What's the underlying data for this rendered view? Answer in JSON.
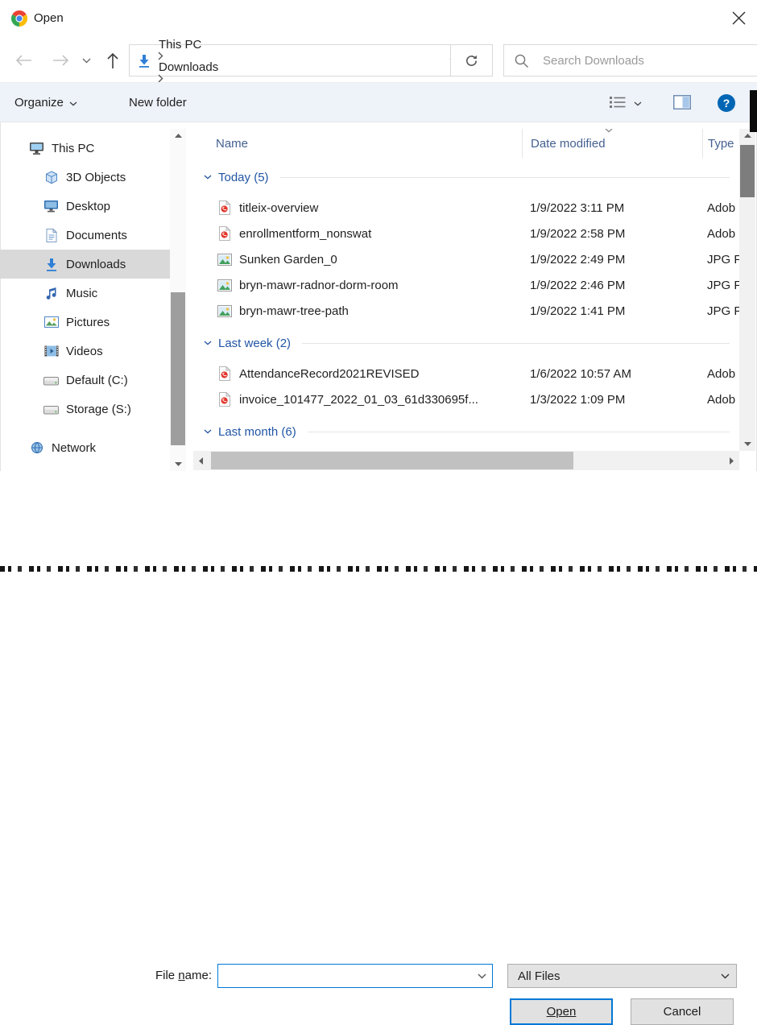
{
  "titlebar": {
    "title": "Open",
    "app_icon": "chrome-logo",
    "close_icon": "close-x"
  },
  "nav": {
    "back_icon": "arrow-left",
    "forward_icon": "arrow-right",
    "recent_icon": "chevron-down",
    "up_icon": "arrow-up",
    "breadcrumb": {
      "location_icon": "downloads-folder",
      "items": [
        "This PC",
        "Downloads"
      ]
    },
    "refresh_icon": "refresh",
    "search": {
      "icon": "magnifier",
      "placeholder": "Search Downloads",
      "value": ""
    }
  },
  "toolbar": {
    "organize_label": "Organize",
    "new_folder_label": "New folder",
    "view_icon": "list-view",
    "preview_icon": "preview-pane",
    "help_icon": "help-question"
  },
  "sidebar": {
    "items": [
      {
        "label": "This PC",
        "icon": "pc",
        "level": 0,
        "selected": false,
        "gap_before": false
      },
      {
        "label": "3D Objects",
        "icon": "cube",
        "level": 1,
        "selected": false,
        "gap_before": false
      },
      {
        "label": "Desktop",
        "icon": "desktop",
        "level": 1,
        "selected": false,
        "gap_before": false
      },
      {
        "label": "Documents",
        "icon": "documents",
        "level": 1,
        "selected": false,
        "gap_before": false
      },
      {
        "label": "Downloads",
        "icon": "downloads",
        "level": 1,
        "selected": true,
        "gap_before": false
      },
      {
        "label": "Music",
        "icon": "music",
        "level": 1,
        "selected": false,
        "gap_before": false
      },
      {
        "label": "Pictures",
        "icon": "pictures",
        "level": 1,
        "selected": false,
        "gap_before": false
      },
      {
        "label": "Videos",
        "icon": "videos",
        "level": 1,
        "selected": false,
        "gap_before": false
      },
      {
        "label": "Default (C:)",
        "icon": "drive",
        "level": 1,
        "selected": false,
        "gap_before": false
      },
      {
        "label": "Storage (S:)",
        "icon": "drive",
        "level": 1,
        "selected": false,
        "gap_before": false
      },
      {
        "label": "Network",
        "icon": "network",
        "level": 0,
        "selected": false,
        "gap_before": true
      }
    ]
  },
  "filelist": {
    "columns": [
      {
        "label": "Name",
        "sort": ""
      },
      {
        "label": "Date modified",
        "sort": "desc"
      },
      {
        "label": "Type",
        "sort": ""
      }
    ],
    "groups": [
      {
        "label": "Today (5)",
        "files": [
          {
            "icon": "pdf",
            "name": "titleix-overview",
            "date": "1/9/2022 3:11 PM",
            "type": "Adob"
          },
          {
            "icon": "pdf",
            "name": "enrollmentform_nonswat",
            "date": "1/9/2022 2:58 PM",
            "type": "Adob"
          },
          {
            "icon": "image",
            "name": "Sunken Garden_0",
            "date": "1/9/2022 2:49 PM",
            "type": "JPG F"
          },
          {
            "icon": "image",
            "name": "bryn-mawr-radnor-dorm-room",
            "date": "1/9/2022 2:46 PM",
            "type": "JPG F"
          },
          {
            "icon": "image",
            "name": "bryn-mawr-tree-path",
            "date": "1/9/2022 1:41 PM",
            "type": "JPG F"
          }
        ]
      },
      {
        "label": "Last week (2)",
        "files": [
          {
            "icon": "pdf",
            "name": "AttendanceRecord2021REVISED",
            "date": "1/6/2022 10:57 AM",
            "type": "Adob"
          },
          {
            "icon": "pdf",
            "name": "invoice_101477_2022_01_03_61d330695f...",
            "date": "1/3/2022 1:09 PM",
            "type": "Adob"
          }
        ]
      },
      {
        "label": "Last month (6)",
        "files": [],
        "partial_file": {
          "icon": "pdf"
        }
      }
    ]
  },
  "footer": {
    "filename_label": {
      "pre": "File ",
      "accel": "n",
      "post": "ame:"
    },
    "filename_value": "",
    "filetype_value": "All Files",
    "open_label": "Open",
    "cancel_label": "Cancel"
  },
  "colors": {
    "accent": "#0078d7",
    "group_header_blue": "#2155a4",
    "column_header_blue": "#44608f",
    "selected_sidebar_bg": "#d9d9d9",
    "toolbar_bg": "#eef2f9"
  }
}
